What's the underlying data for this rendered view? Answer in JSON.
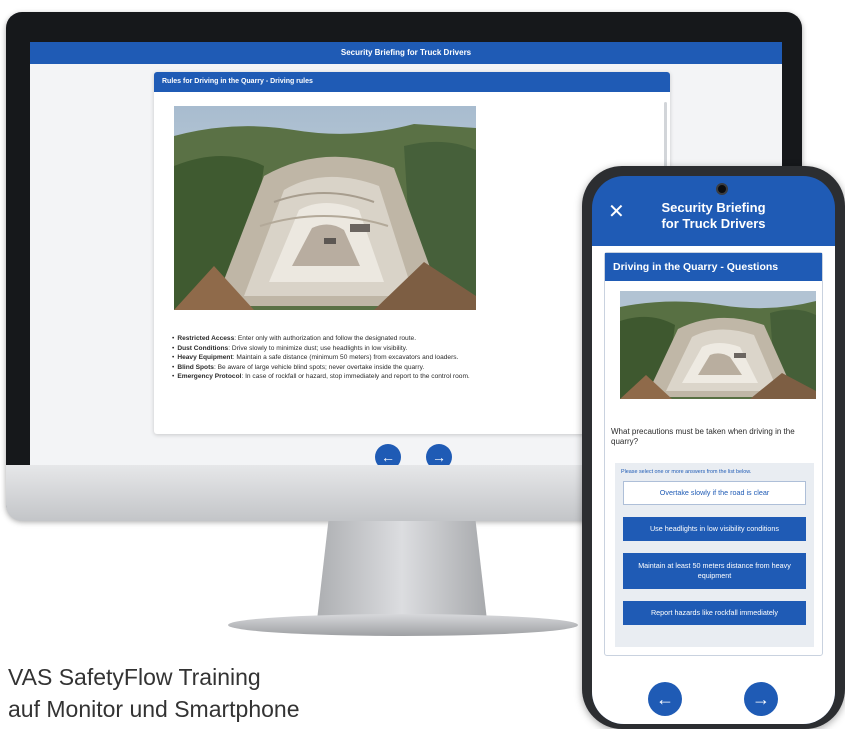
{
  "desktop": {
    "app_title": "Security Briefing for Truck Drivers",
    "card_title": "Rules for Driving in the Quarry - Driving rules",
    "image_alt": "quarry-aerial-photo",
    "rules": [
      {
        "term": "Restricted Access",
        "text": ": Enter only with authorization and follow the designated route."
      },
      {
        "term": "Dust Conditions",
        "text": ": Drive slowly to minimize dust; use headlights in low visibility."
      },
      {
        "term": "Heavy Equipment",
        "text": ": Maintain a safe distance (minimum 50 meters) from excavators and loaders."
      },
      {
        "term": "Blind Spots",
        "text": ": Be aware of large vehicle blind spots; never overtake inside the quarry."
      },
      {
        "term": "Emergency Protocol",
        "text": ": In case of rockfall or hazard, stop immediately and report to the control room."
      }
    ],
    "nav_prev_icon": "arrow-left-icon",
    "nav_next_icon": "arrow-right-icon"
  },
  "phone": {
    "title_line1": "Security Briefing",
    "title_line2": "for Truck Drivers",
    "close_icon": "close-icon",
    "card_title": "Driving in the Quarry - Questions",
    "question": "What precautions must be taken when driving in the quarry?",
    "hint": "Please select one or more answers from the list below.",
    "answers": [
      {
        "label": "Overtake slowly if the road is clear",
        "selected": false
      },
      {
        "label": "Use headlights in low visibility conditions",
        "selected": true
      },
      {
        "label": "Maintain at least 50 meters distance from heavy equipment",
        "selected": true
      },
      {
        "label": "Report hazards like rockfall immediately",
        "selected": true
      }
    ]
  },
  "caption": {
    "line1": "VAS SafetyFlow Training",
    "line2": "auf Monitor und Smartphone"
  },
  "colors": {
    "brand_blue": "#1f5bb5",
    "monitor_bezel": "#16181b",
    "panel_grey": "#e9edf2"
  }
}
